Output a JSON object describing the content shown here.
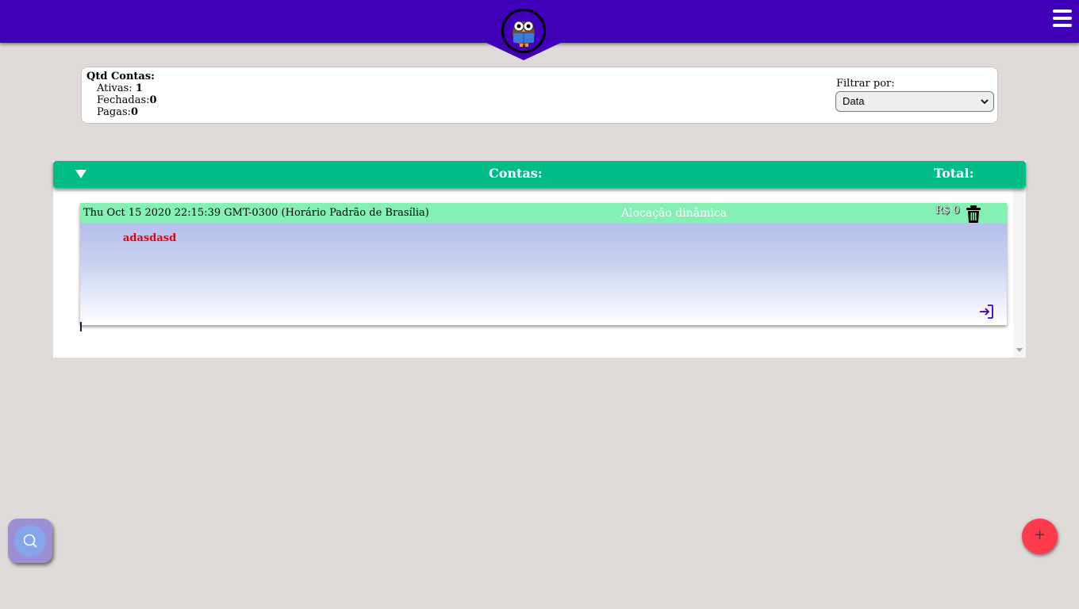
{
  "header": {
    "logo_icon": "owl-reading-icon",
    "menu_icon": "hamburger-menu-icon",
    "accent_color": "#3f00b8"
  },
  "summary": {
    "title": "Qtd Contas:",
    "ativas_label": "Ativas:",
    "ativas_value": "1",
    "fechadas_label": "Fechadas:",
    "fechadas_value": "0",
    "pagas_label": "Pagas:",
    "pagas_value": "0",
    "filter_label": "Filtrar por:",
    "filter_selected": "Data"
  },
  "panel": {
    "title": "Contas:",
    "total_label": "Total:",
    "header_color": "#00bc87"
  },
  "accounts": [
    {
      "date": "Thu Oct 15 2020 22:15:39 GMT-0300 (Horário Padrão de Brasília)",
      "type": "Alocação dinâmica",
      "value": "R$ 0",
      "description": "adasdasd"
    }
  ],
  "fab": {
    "search_icon": "search-icon",
    "add_label": "+",
    "add_color": "#ff3b4e"
  }
}
